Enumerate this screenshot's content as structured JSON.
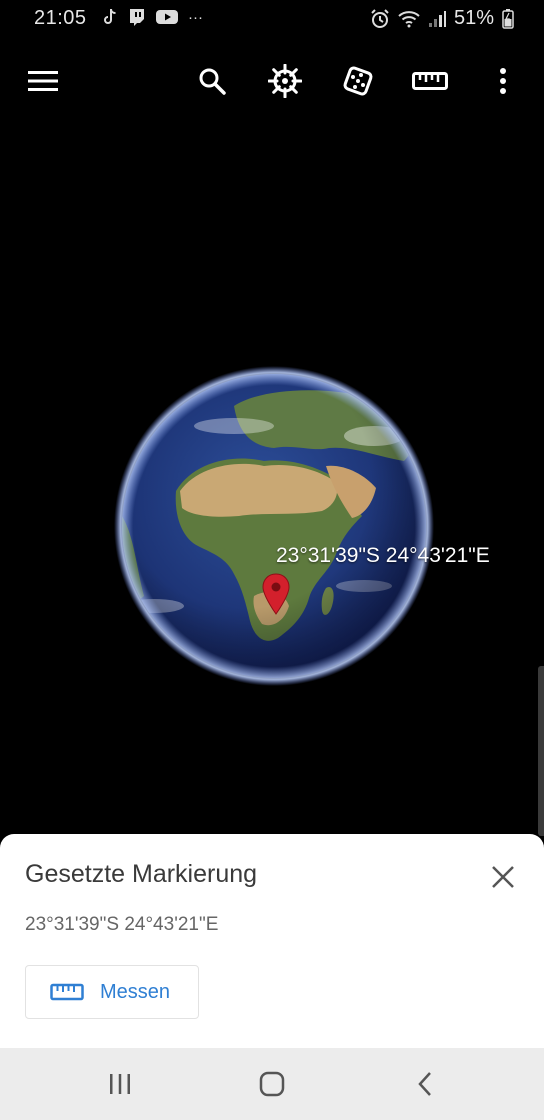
{
  "status_bar": {
    "time": "21:05",
    "notification_icons": [
      "tiktok-icon",
      "twitch-icon",
      "youtube-icon",
      "more-notifications-icon"
    ],
    "more_label": "···",
    "battery_text": "51%"
  },
  "toolbar": {
    "icons": [
      "menu-icon",
      "search-icon",
      "voyager-wheel-icon",
      "dice-icon",
      "ruler-icon",
      "more-vert-icon"
    ]
  },
  "map": {
    "coordinate_label": "23°31'39\"S 24°43'21\"E"
  },
  "sheet": {
    "title": "Gesetzte Markierung",
    "coordinates": "23°31'39\"S 24°43'21\"E",
    "measure_label": "Messen"
  },
  "colors": {
    "accent_blue": "#2f7fd3",
    "pin_red": "#d3202c",
    "background": "#000000"
  }
}
